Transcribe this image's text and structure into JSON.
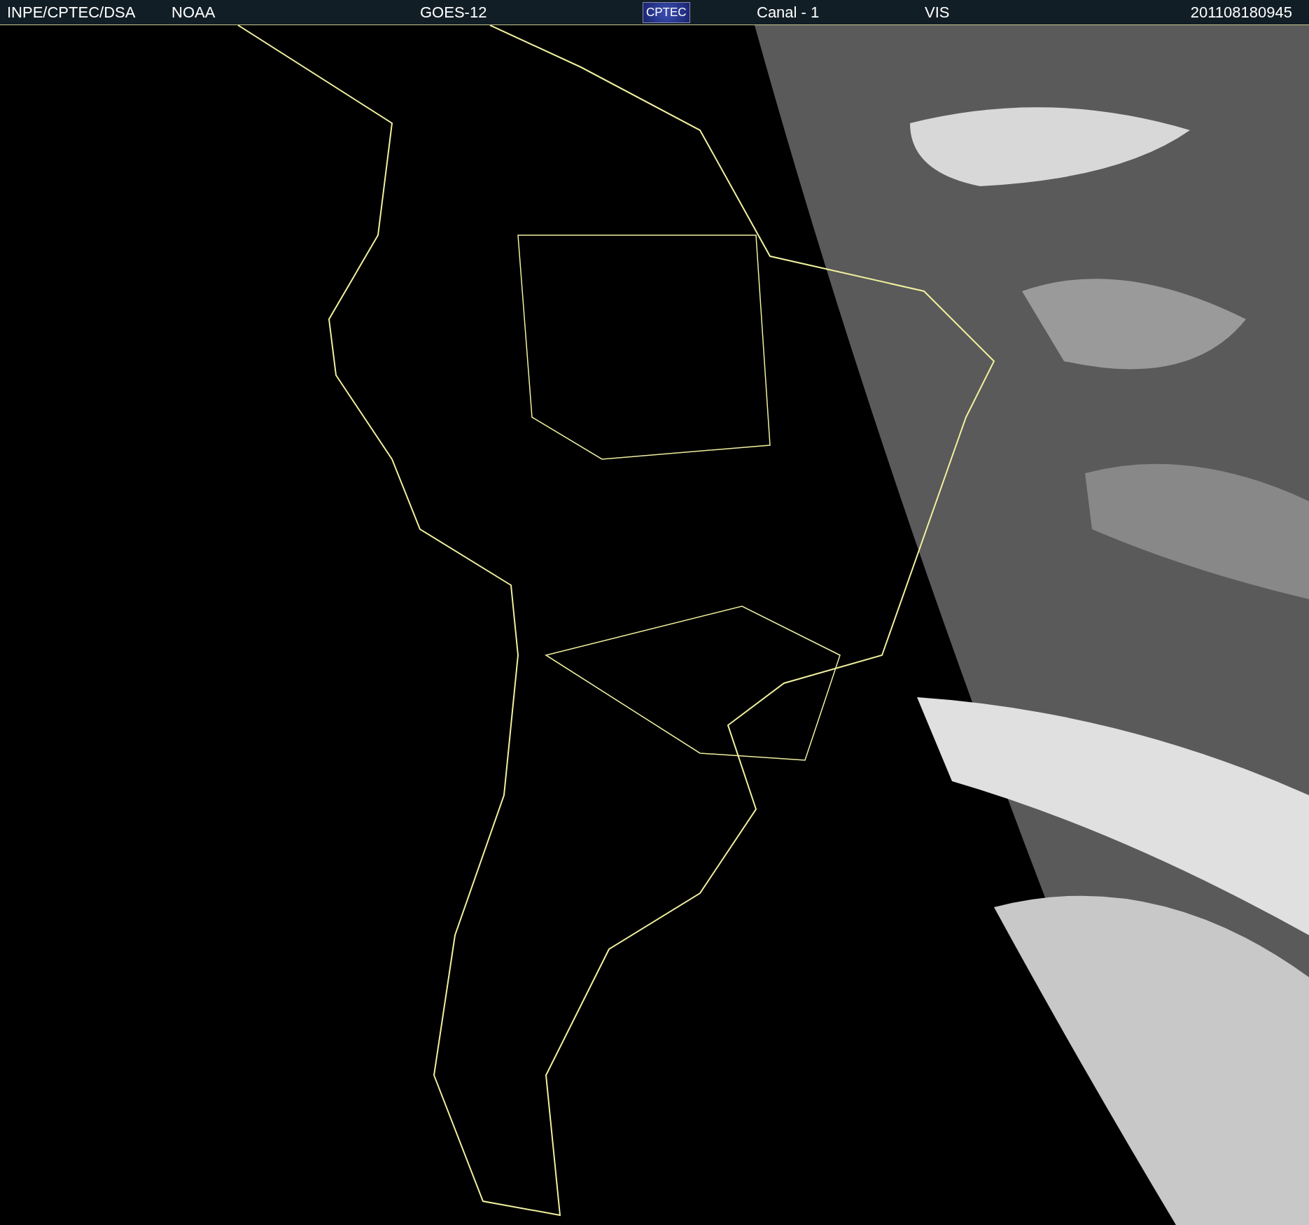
{
  "header": {
    "source": "INPE/CPTEC/DSA",
    "agency": "NOAA",
    "satellite": "GOES-12",
    "logo": "CPTEC",
    "channel": "Canal - 1",
    "band": "VIS",
    "timestamp": "201108180945"
  }
}
